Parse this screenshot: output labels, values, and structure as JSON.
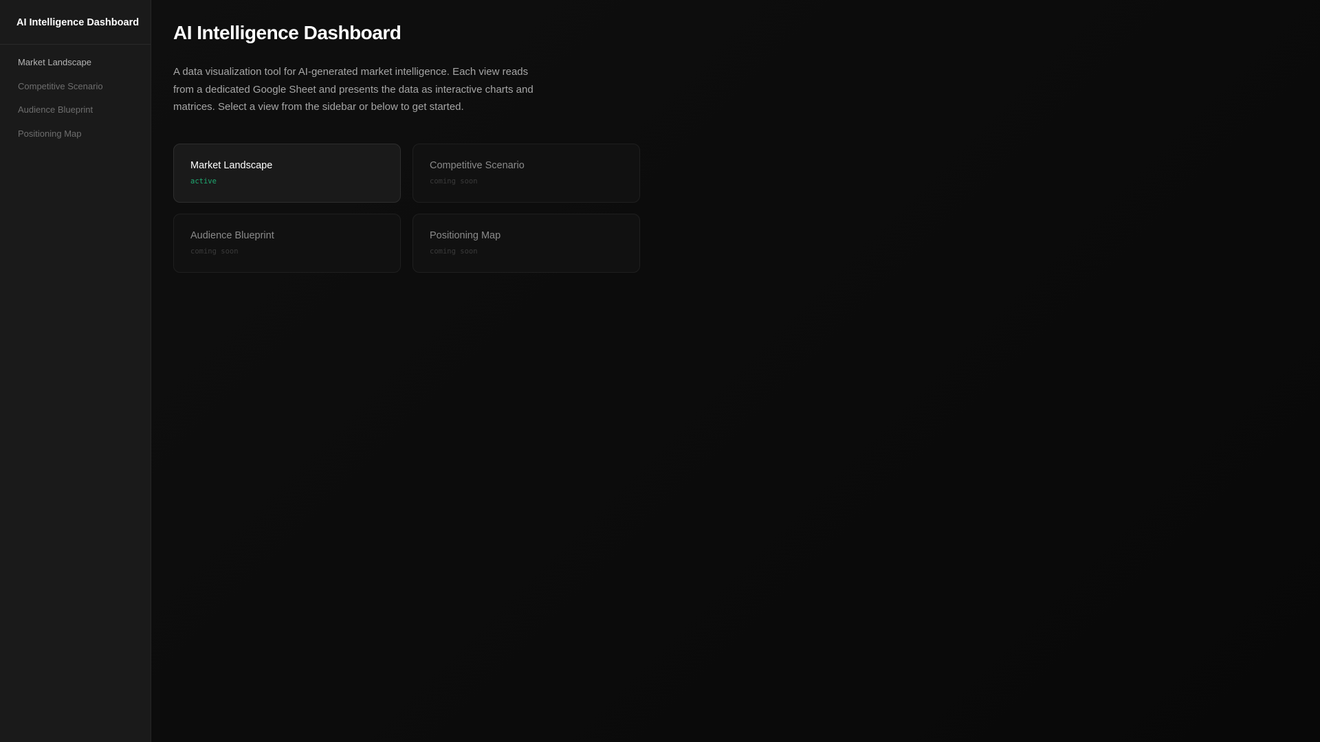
{
  "sidebar": {
    "title": "AI Intelligence Dashboard",
    "items": [
      {
        "label": "Market Landscape"
      },
      {
        "label": "Competitive Scenario"
      },
      {
        "label": "Audience Blueprint"
      },
      {
        "label": "Positioning Map"
      }
    ]
  },
  "main": {
    "title": "AI Intelligence Dashboard",
    "description": "A data visualization tool for AI-generated market intelligence. Each view reads from a dedicated Google Sheet and presents the data as interactive charts and matrices. Select a view from the sidebar or below to get started.",
    "cards": [
      {
        "title": "Market Landscape",
        "status": "active"
      },
      {
        "title": "Competitive Scenario",
        "status": "coming soon"
      },
      {
        "title": "Audience Blueprint",
        "status": "coming soon"
      },
      {
        "title": "Positioning Map",
        "status": "coming soon"
      }
    ]
  },
  "colors": {
    "accent": "#1fa971"
  }
}
